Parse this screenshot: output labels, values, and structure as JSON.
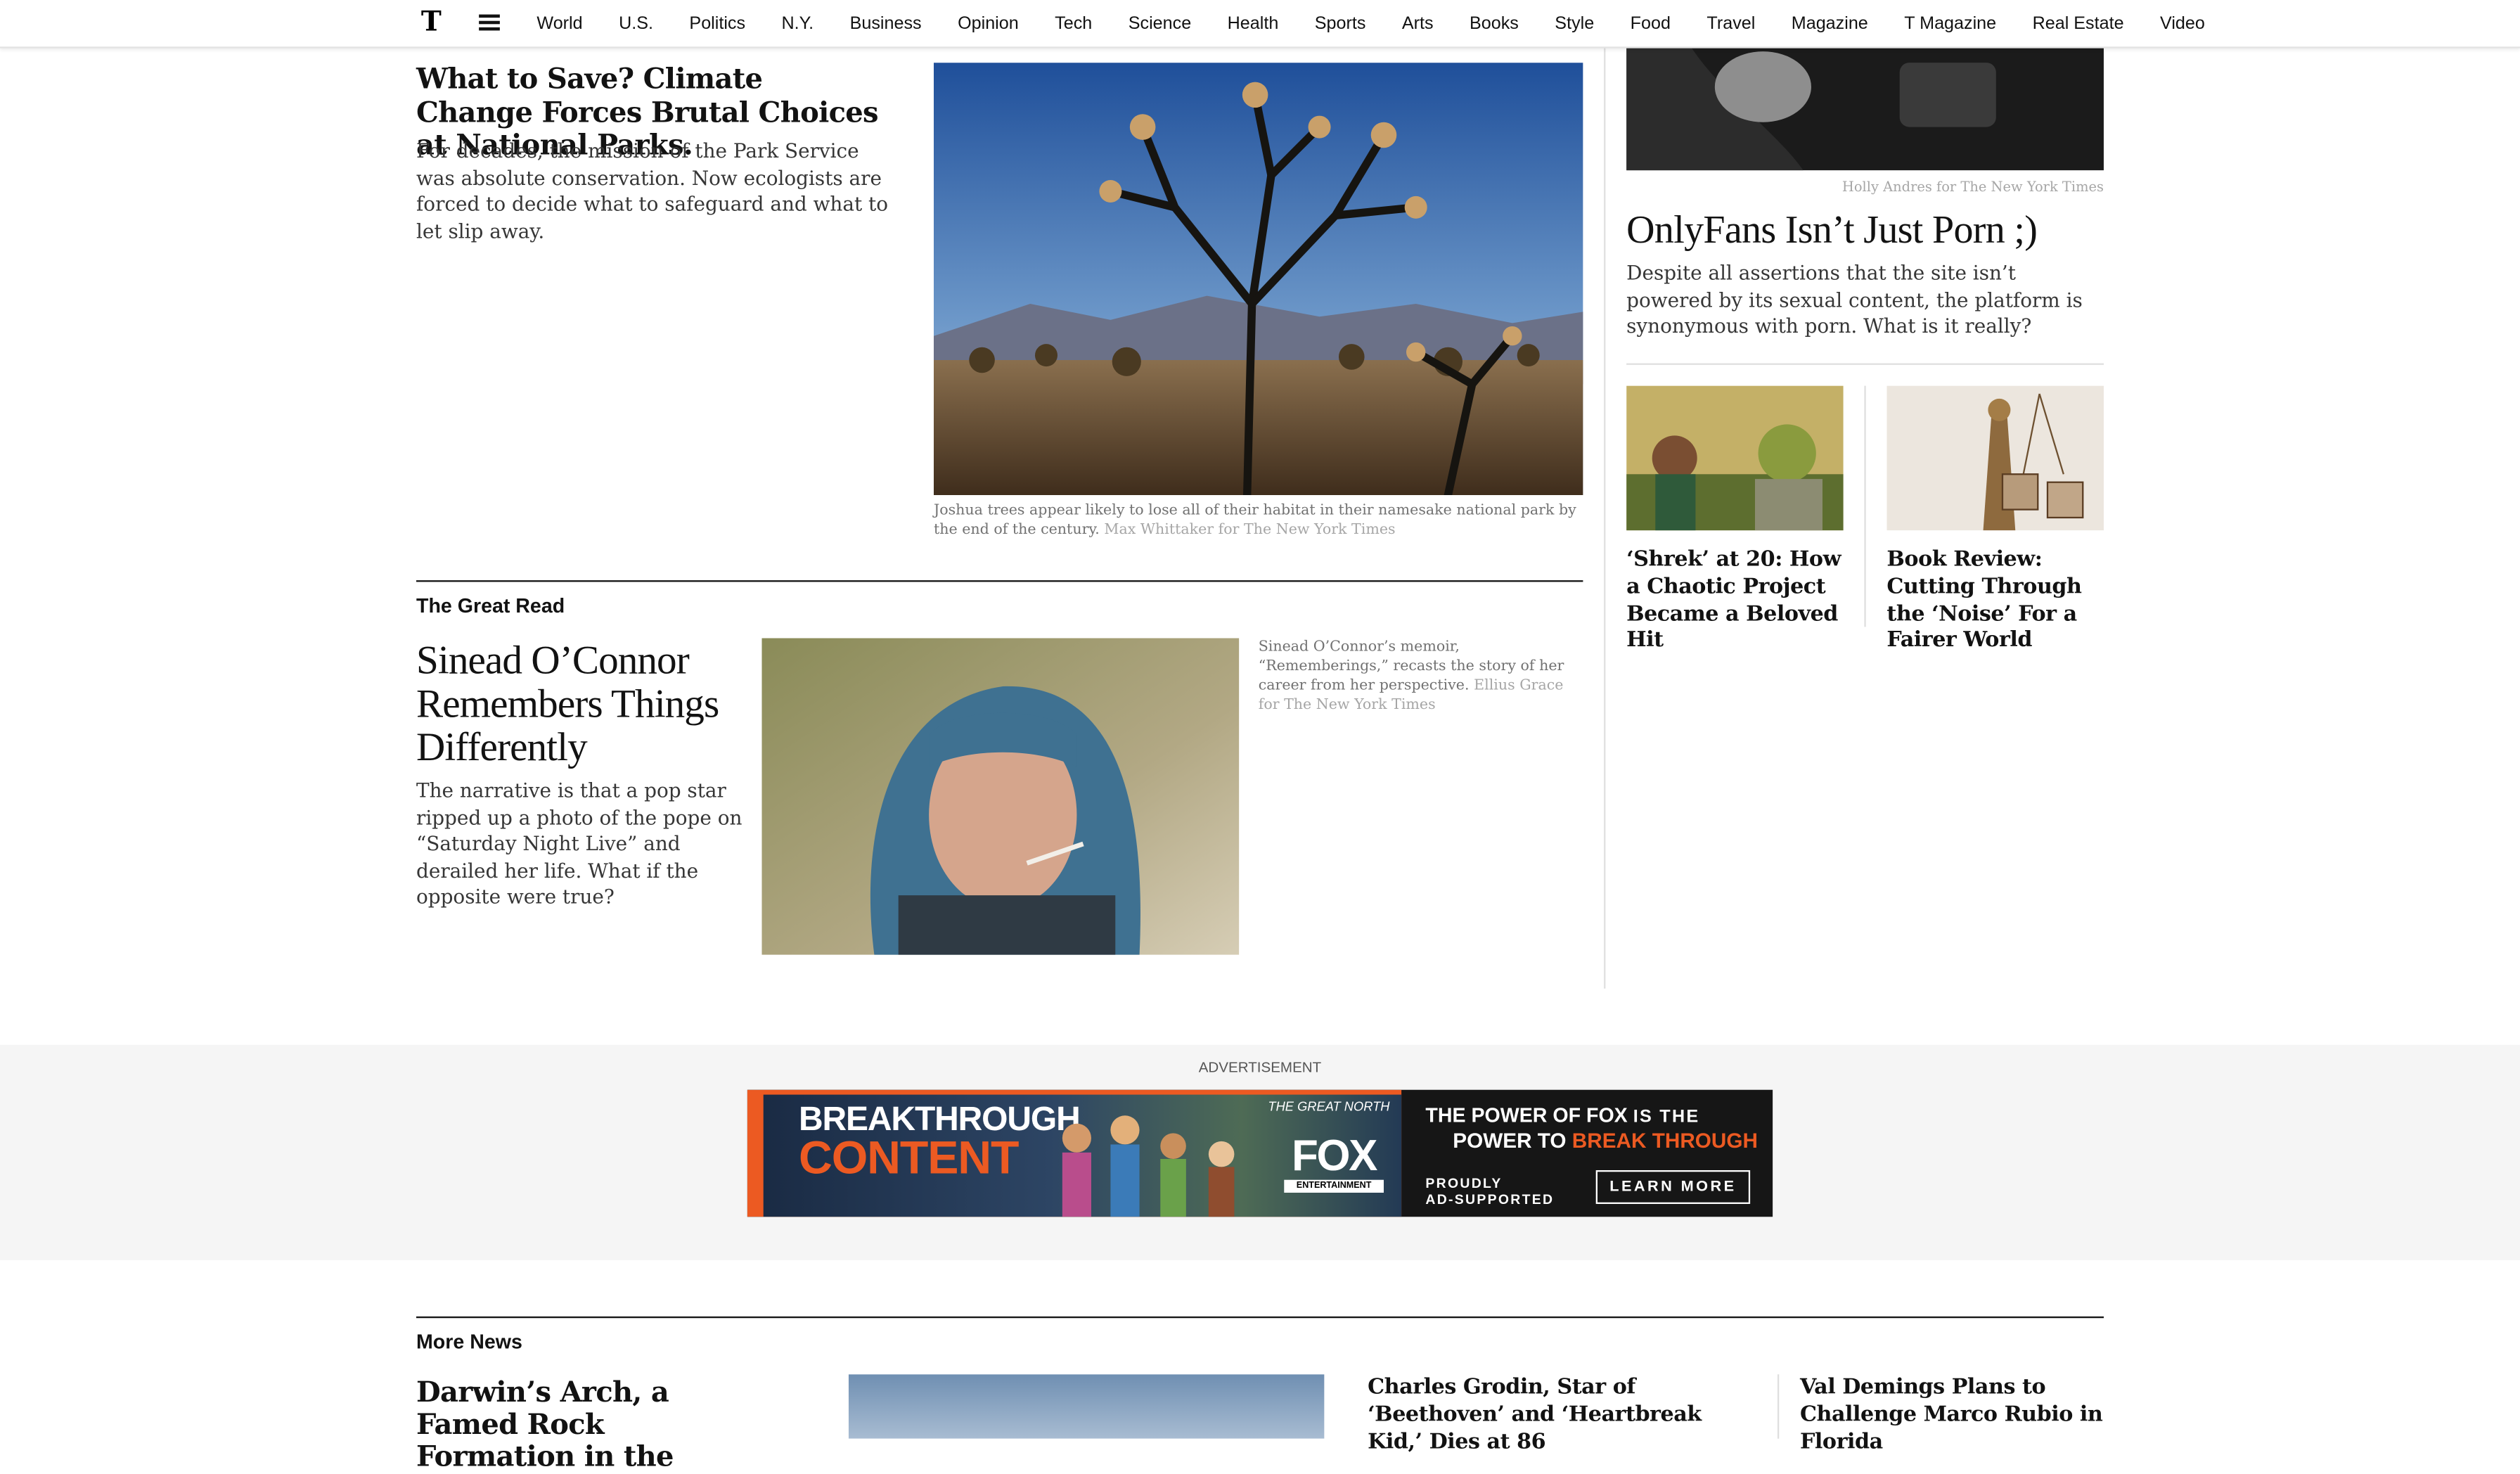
{
  "nav": {
    "logo": "T",
    "items": [
      "World",
      "U.S.",
      "Politics",
      "N.Y.",
      "Business",
      "Opinion",
      "Tech",
      "Science",
      "Health",
      "Sports",
      "Arts",
      "Books",
      "Style",
      "Food",
      "Travel",
      "Magazine",
      "T Magazine",
      "Real Estate",
      "Video"
    ]
  },
  "parks": {
    "headline": "What to Save? Climate Change Forces Brutal Choices at National Parks.",
    "summary": "For decades, the mission of the Park Service was absolute conservation. Now ecologists are forced to decide what to safeguard and what to let slip away.",
    "caption": "Joshua trees appear likely to lose all of their habitat in their namesake national park by the end of the century.",
    "credit": "Max Whittaker for The New York Times"
  },
  "great_read": {
    "label": "The Great Read",
    "headline": "Sinead O’Connor Remembers Things Differently",
    "summary": "The narrative is that a pop star ripped up a photo of the pope on “Saturday Night Live” and derailed her life. What if the opposite were true?",
    "caption": "Sinead O’Connor’s memoir, “Rememberings,” recasts the story of her career from her perspective.",
    "credit": "Ellius Grace for The New York Times"
  },
  "onlyfans": {
    "credit": "Holly Andres for The New York Times",
    "headline": "OnlyFans Isn’t Just Porn ;)",
    "summary": "Despite all assertions that the site isn’t powered by its sexual content, the platform is synonymous with porn. What is it really?"
  },
  "shrek": {
    "headline": "‘Shrek’ at 20: How a Chaotic Project Became a Beloved Hit"
  },
  "book_review": {
    "headline": "Book Review: Cutting Through the ‘Noise’ For a Fairer World"
  },
  "ad": {
    "label": "ADVERTISEMENT",
    "line1": "BREAKTHROUGH",
    "line2": "CONTENT",
    "show": "THE GREAT NORTH",
    "brand": "FOX",
    "brand_sub": "ENTERTAINMENT",
    "tag1a": "THE POWER OF FOX",
    "tag1b": "IS THE",
    "tag2a": "POWER TO",
    "tag2b": "BREAK THROUGH",
    "proudly": "PROUDLY",
    "supported": "AD-SUPPORTED",
    "cta": "LEARN MORE",
    "colors": {
      "orange": "#ec5a22",
      "dark": "#161616"
    }
  },
  "more_news": {
    "label": "More News",
    "darwin": "Darwin’s Arch, a Famed Rock Formation in the",
    "grodin": "Charles Grodin, Star of ‘Beethoven’ and ‘Heartbreak Kid,’ Dies at 86",
    "demings": "Val Demings Plans to Challenge Marco Rubio in Florida"
  }
}
